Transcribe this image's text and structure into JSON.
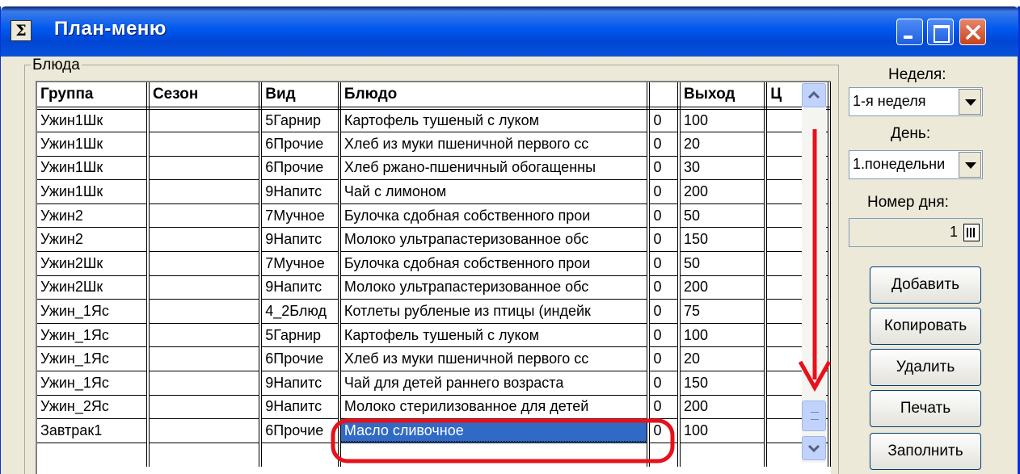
{
  "window": {
    "title": "План-меню",
    "icon_glyph": "Σ"
  },
  "titlebar_buttons": [
    "minimize-icon",
    "maximize-icon",
    "close-icon"
  ],
  "group": {
    "label": "Блюда"
  },
  "grid": {
    "columns": [
      "Группа",
      "Сезон",
      "Вид",
      "Блюдо",
      "",
      "Выход",
      "Ц"
    ],
    "rows": [
      [
        "Ужин1Шк",
        "",
        "5Гарнир",
        "Картофель тушеный с луком",
        "0",
        "100",
        ""
      ],
      [
        "Ужин1Шк",
        "",
        "6Прочие",
        "Хлеб из муки пшеничной первого сс",
        "0",
        "20",
        ""
      ],
      [
        "Ужин1Шк",
        "",
        "6Прочие",
        "Хлеб ржано-пшеничный обогащенны",
        "0",
        "30",
        ""
      ],
      [
        "Ужин1Шк",
        "",
        "9Напитс",
        "Чай с лимоном",
        "0",
        "200",
        ""
      ],
      [
        "Ужин2",
        "",
        "7Мучное",
        "Булочка сдобная собственного прои",
        "0",
        "50",
        ""
      ],
      [
        "Ужин2",
        "",
        "9Напитс",
        "Молоко ультрапастеризованное обс",
        "0",
        "150",
        ""
      ],
      [
        "Ужин2Шк",
        "",
        "7Мучное",
        "Булочка сдобная собственного прои",
        "0",
        "50",
        ""
      ],
      [
        "Ужин2Шк",
        "",
        "9Напитс",
        "Молоко ультрапастеризованное обс",
        "0",
        "200",
        ""
      ],
      [
        "Ужин_1Яс",
        "",
        "4_2Блюд",
        "Котлеты рубленые из птицы (индейк",
        "0",
        "75",
        ""
      ],
      [
        "Ужин_1Яс",
        "",
        "5Гарнир",
        "Картофель тушеный с луком",
        "0",
        "100",
        ""
      ],
      [
        "Ужин_1Яс",
        "",
        "6Прочие",
        "Хлеб из муки пшеничной первого сс",
        "0",
        "20",
        ""
      ],
      [
        "Ужин_1Яс",
        "",
        "9Напитс",
        "Чай для детей раннего возраста",
        "0",
        "150",
        ""
      ],
      [
        "Ужин_2Яс",
        "",
        "9Напитс",
        "Молоко стерилизованное для детей",
        "0",
        "200",
        ""
      ],
      [
        "Завтрак1",
        "",
        "6Прочие",
        "Масло сливочное",
        "0",
        "100",
        ""
      ],
      [
        "",
        "",
        "",
        "",
        "",
        "",
        ""
      ]
    ],
    "selected_row": 13,
    "selected_color": "#316ac5"
  },
  "panel": {
    "week_label": "Неделя:",
    "week_value": "1-я неделя",
    "day_label": "День:",
    "day_value": "1.понедельни",
    "daynum_label": "Номер дня:",
    "daynum_value": "1",
    "buttons": [
      "Добавить",
      "Копировать",
      "Удалить",
      "Печать",
      "Заполнить"
    ]
  },
  "annotation_color": "#e8101a"
}
